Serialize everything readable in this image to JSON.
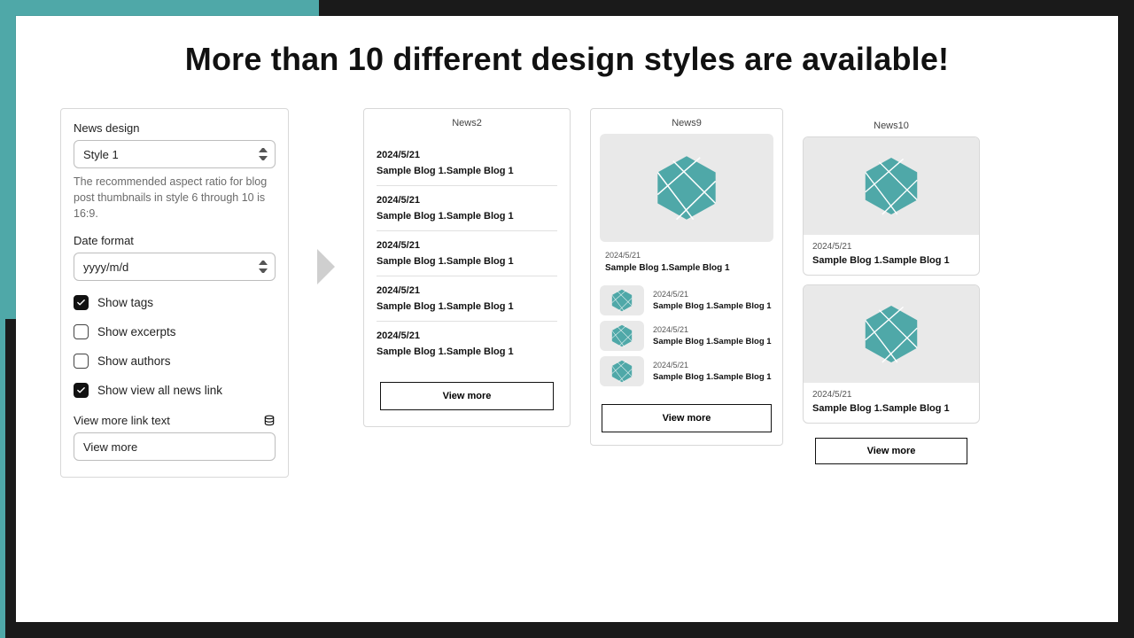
{
  "headline": "More than 10 different design styles are available!",
  "settings": {
    "design_label": "News design",
    "design_value": "Style 1",
    "design_help": "The recommended aspect ratio for blog post thumbnails in style 6 through 10 is 16:9.",
    "date_label": "Date format",
    "date_value": "yyyy/m/d",
    "show_tags": "Show tags",
    "show_excerpts": "Show excerpts",
    "show_authors": "Show authors",
    "show_viewall": "Show view all news link",
    "linktext_label": "View more link text",
    "linktext_value": "View more"
  },
  "previews": {
    "news2": {
      "title": "News2",
      "items": [
        {
          "date": "2024/5/21",
          "title": "Sample Blog 1.Sample Blog 1"
        },
        {
          "date": "2024/5/21",
          "title": "Sample Blog 1.Sample Blog 1"
        },
        {
          "date": "2024/5/21",
          "title": "Sample Blog 1.Sample Blog 1"
        },
        {
          "date": "2024/5/21",
          "title": "Sample Blog 1.Sample Blog 1"
        },
        {
          "date": "2024/5/21",
          "title": "Sample Blog 1.Sample Blog 1"
        }
      ],
      "viewmore": "View more"
    },
    "news9": {
      "title": "News9",
      "feature": {
        "date": "2024/5/21",
        "title": "Sample Blog 1.Sample Blog 1"
      },
      "rows": [
        {
          "date": "2024/5/21",
          "title": "Sample Blog 1.Sample Blog 1"
        },
        {
          "date": "2024/5/21",
          "title": "Sample Blog 1.Sample Blog 1"
        },
        {
          "date": "2024/5/21",
          "title": "Sample Blog 1.Sample Blog 1"
        }
      ],
      "viewmore": "View more"
    },
    "news10": {
      "title": "News10",
      "cards": [
        {
          "date": "2024/5/21",
          "title": "Sample Blog 1.Sample Blog 1"
        },
        {
          "date": "2024/5/21",
          "title": "Sample Blog 1.Sample Blog 1"
        }
      ],
      "viewmore": "View more"
    }
  },
  "colors": {
    "teal": "#4fa8a8"
  }
}
